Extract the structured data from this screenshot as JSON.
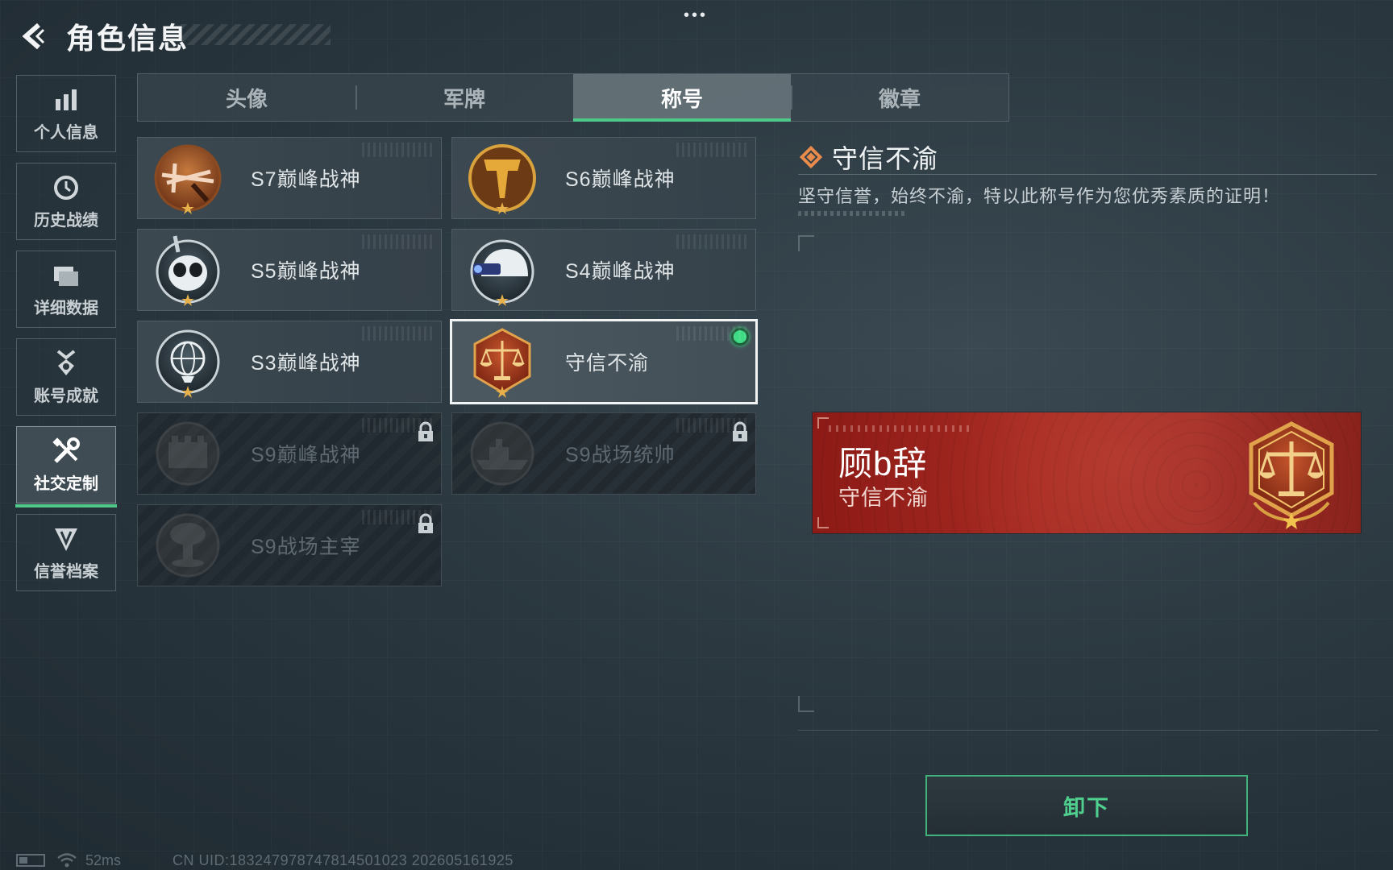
{
  "header": {
    "title": "角色信息",
    "more_dots": "•••"
  },
  "sidebar": {
    "items": [
      {
        "label": "个人信息",
        "icon": "bar-chart-icon"
      },
      {
        "label": "历史战绩",
        "icon": "history-clock-icon"
      },
      {
        "label": "详细数据",
        "icon": "folder-icon"
      },
      {
        "label": "账号成就",
        "icon": "medal-icon"
      },
      {
        "label": "社交定制",
        "icon": "tools-icon",
        "active": true
      },
      {
        "label": "信誉档案",
        "icon": "reputation-shield-icon"
      }
    ]
  },
  "tabs": [
    {
      "label": "头像"
    },
    {
      "label": "军牌"
    },
    {
      "label": "称号",
      "active": true
    },
    {
      "label": "徽章"
    }
  ],
  "titles": [
    {
      "name": "S7巅峰战神",
      "emblem": "crossbow-emblem-icon",
      "locked": false
    },
    {
      "name": "S6巅峰战神",
      "emblem": "t-shield-emblem-icon",
      "locked": false
    },
    {
      "name": "S5巅峰战神",
      "emblem": "diver-skull-emblem-icon",
      "locked": false
    },
    {
      "name": "S4巅峰战神",
      "emblem": "helmet-nightvision-emblem-icon",
      "locked": false
    },
    {
      "name": "S3巅峰战神",
      "emblem": "globe-emblem-icon",
      "locked": false
    },
    {
      "name": "守信不渝",
      "emblem": "scales-emblem-icon",
      "locked": false,
      "selected": true,
      "equipped": true
    },
    {
      "name": "S9巅峰战神",
      "emblem": "fortress-emblem-icon",
      "locked": true
    },
    {
      "name": "S9战场统帅",
      "emblem": "warship-emblem-icon",
      "locked": true
    },
    {
      "name": "S9战场主宰",
      "emblem": "mushroom-cloud-emblem-icon",
      "locked": true
    }
  ],
  "detail": {
    "title": "守信不渝",
    "description": "坚守信誉，始终不渝，特以此称号作为您优秀素质的证明！"
  },
  "nameplate": {
    "player_name": "顾b辞",
    "title": "守信不渝",
    "emblem": "scales-emblem-icon"
  },
  "actions": {
    "unequip_label": "卸下"
  },
  "status_bar": {
    "ping": "52ms",
    "uid": "CN UID:1832479787478145010​23 202605161925"
  },
  "colors": {
    "accent_green": "#4fc98a",
    "equipped_dot": "#3ddc84",
    "nameplate_red": "#a52a22",
    "emblem_bronze": "#b86a32"
  }
}
